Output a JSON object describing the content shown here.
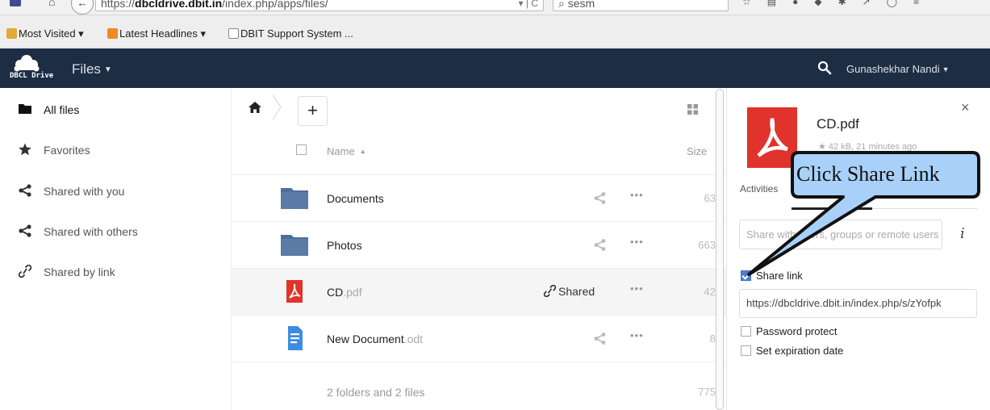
{
  "browser": {
    "url_prefix": "https://",
    "url_host": "dbcldrive.dbit.in",
    "url_path": "/index.php/apps/files/",
    "url_controls": "▾ | C",
    "search_value": "sesm"
  },
  "bookmarks": {
    "items": [
      {
        "label": "Most Visited ▾",
        "icon": "folder-icon"
      },
      {
        "label": "Latest Headlines ▾",
        "icon": "rss-icon"
      },
      {
        "label": "DBIT Support System ...",
        "icon": "page-icon"
      }
    ]
  },
  "header": {
    "logo_text": "DBCL Drive",
    "app_name": "Files",
    "user_name": "Gunashekhar Nandi",
    "bg_color": "#1d2d44"
  },
  "nav": {
    "items": [
      {
        "label": "All files",
        "icon": "folder-icon"
      },
      {
        "label": "Favorites",
        "icon": "star-icon"
      },
      {
        "label": "Shared with you",
        "icon": "share-icon"
      },
      {
        "label": "Shared with others",
        "icon": "share-icon"
      },
      {
        "label": "Shared by link",
        "icon": "link-icon"
      }
    ]
  },
  "files": {
    "new_button": "+",
    "columns": {
      "name": "Name",
      "size": "Size"
    },
    "rows": [
      {
        "name": "Documents",
        "ext": "",
        "type": "folder",
        "size": "63",
        "shared_label": ""
      },
      {
        "name": "Photos",
        "ext": "",
        "type": "folder",
        "size": "663",
        "shared_label": ""
      },
      {
        "name": "CD",
        "ext": ".pdf",
        "type": "pdf",
        "size": "42",
        "shared_label": "Shared"
      },
      {
        "name": "New Document",
        "ext": ".odt",
        "type": "document",
        "size": "8",
        "shared_label": ""
      }
    ],
    "more_label": "•••",
    "summary": "2 folders and 2 files",
    "summary_size": "775"
  },
  "details": {
    "filename": "CD.pdf",
    "meta": "★ 42 kB, 21 minutes ago",
    "close_label": "×",
    "tab_activities": "Activities",
    "share_placeholder": "Share with users, groups or remote users",
    "info_label": "i",
    "share_link_label": "Share link",
    "share_link_checked": true,
    "link_url": "https://dbcldrive.dbit.in/index.php/s/zYofpk",
    "password_protect_label": "Password protect",
    "expiration_label": "Set expiration date"
  },
  "annotation": {
    "callout_text": "Click Share Link",
    "callout_color": "#a8d0f8"
  }
}
